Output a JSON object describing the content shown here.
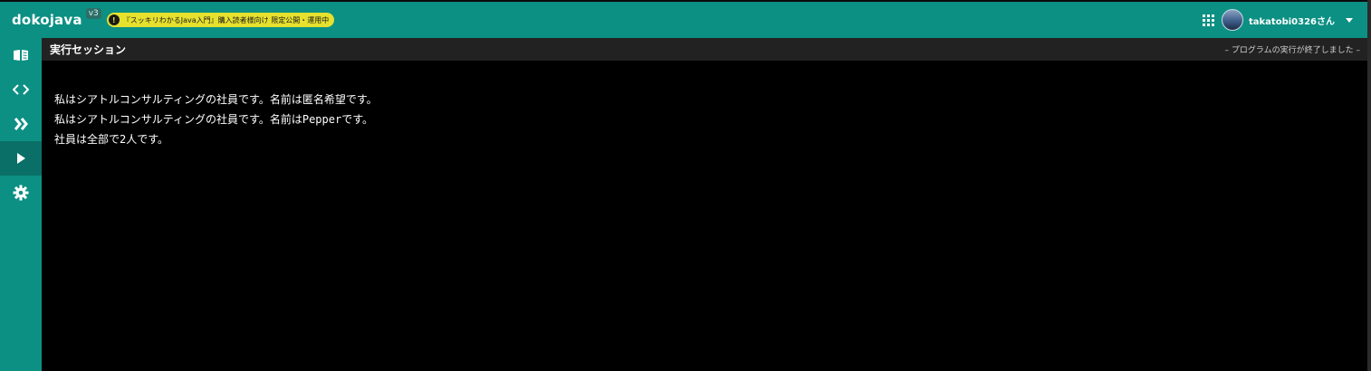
{
  "app": {
    "brand": "dokojava",
    "version": "v3",
    "notice": {
      "icon": "exclamation-icon",
      "text": "『スッキリわかるJava入門』購入読者様向け 限定公開・運用中"
    },
    "user": {
      "name": "takatobi0326さん"
    }
  },
  "sidebar": {
    "items": [
      {
        "name": "book-icon",
        "active": false
      },
      {
        "name": "code-icon",
        "active": false
      },
      {
        "name": "double-chevron-icon",
        "active": false
      },
      {
        "name": "play-icon",
        "active": true
      },
      {
        "name": "gear-icon",
        "active": false
      }
    ]
  },
  "session": {
    "title": "実行セッション",
    "status": "– プログラムの実行が終了しました –",
    "output": [
      "私はシアトルコンサルティングの社員です。名前は匿名希望です。",
      "私はシアトルコンサルティングの社員です。名前はPepperです。",
      "社員は全部で2人です。"
    ]
  },
  "colors": {
    "accent": "#0c9083",
    "notice": "#e6e12e",
    "console_bg": "#000000"
  }
}
